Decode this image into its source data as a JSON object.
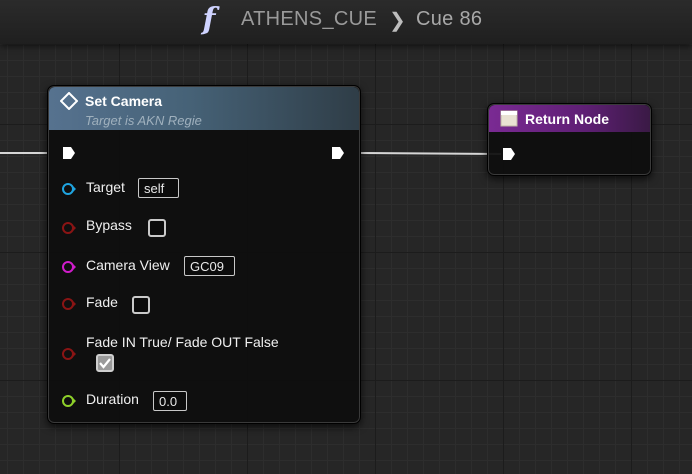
{
  "breadcrumb": {
    "graph": "ATHENS_CUE",
    "separator": "❯",
    "current": "Cue 86"
  },
  "colors": {
    "exec": "#ffffff",
    "object_pin": "#1fa4e0",
    "bool_pin": "#8a1414",
    "name_pin": "#d01ccb",
    "float_pin": "#8ed02a",
    "set_camera_header": "#56728f",
    "return_header": "#7a2a93"
  },
  "set_camera": {
    "title": "Set Camera",
    "subtitle": "Target is AKN Regie",
    "icon": "function-diamond-icon",
    "pins": {
      "target": {
        "label": "Target",
        "value": "self"
      },
      "bypass": {
        "label": "Bypass",
        "checked": false
      },
      "camera_view": {
        "label": "Camera View",
        "value": "GC09"
      },
      "fade": {
        "label": "Fade",
        "checked": false
      },
      "fade_in": {
        "label": "Fade IN True/ Fade OUT False",
        "checked": true
      },
      "duration": {
        "label": "Duration",
        "value": "0.0"
      }
    }
  },
  "return_node": {
    "title": "Return Node",
    "icon": "return-node-icon"
  }
}
